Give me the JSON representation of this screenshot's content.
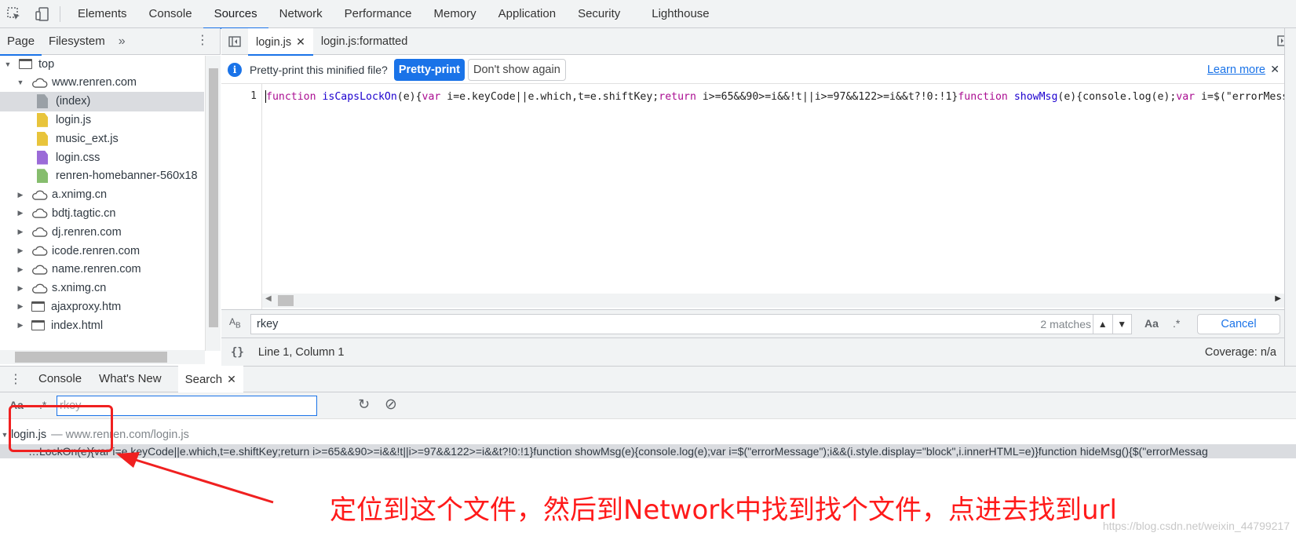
{
  "main_tabs": [
    "Elements",
    "Console",
    "Sources",
    "Network",
    "Performance",
    "Memory",
    "Application",
    "Security",
    "Lighthouse"
  ],
  "active_main_tab": "Sources",
  "navigator": {
    "tabs": [
      "Page",
      "Filesystem"
    ],
    "more": "»",
    "tree": [
      {
        "label": "top",
        "type": "frame",
        "expanded": true,
        "depth": 0
      },
      {
        "label": "www.renren.com",
        "type": "domain",
        "expanded": true,
        "depth": 1
      },
      {
        "label": "(index)",
        "type": "file-doc",
        "depth": 2,
        "selected": true
      },
      {
        "label": "login.js",
        "type": "file-script",
        "depth": 2
      },
      {
        "label": "music_ext.js",
        "type": "file-script",
        "depth": 2
      },
      {
        "label": "login.css",
        "type": "file-style",
        "depth": 2
      },
      {
        "label": "renren-homebanner-560x18",
        "type": "file-image",
        "depth": 2
      },
      {
        "label": "a.xnimg.cn",
        "type": "domain",
        "depth": 1
      },
      {
        "label": "bdtj.tagtic.cn",
        "type": "domain",
        "depth": 1
      },
      {
        "label": "dj.renren.com",
        "type": "domain",
        "depth": 1
      },
      {
        "label": "icode.renren.com",
        "type": "domain",
        "depth": 1
      },
      {
        "label": "name.renren.com",
        "type": "domain",
        "depth": 1
      },
      {
        "label": "s.xnimg.cn",
        "type": "domain",
        "depth": 1
      },
      {
        "label": "ajaxproxy.htm",
        "type": "frame",
        "depth": 1
      },
      {
        "label": "index.html",
        "type": "frame",
        "depth": 1
      }
    ]
  },
  "editor": {
    "tabs": [
      {
        "label": "login.js",
        "closable": true
      },
      {
        "label": "login.js:formatted",
        "closable": false
      }
    ],
    "infobar": {
      "message": "Pretty-print this minified file?",
      "primary": "Pretty-print",
      "secondary": "Don't show again",
      "learn_more": "Learn more"
    },
    "line_number": "1",
    "code_parts": [
      {
        "t": "function",
        "c": "kw"
      },
      {
        "t": " ",
        "c": ""
      },
      {
        "t": "isCapsLockOn",
        "c": "fn"
      },
      {
        "t": "(e){",
        "c": ""
      },
      {
        "t": "var",
        "c": "kw"
      },
      {
        "t": " i=e.keyCode||e.which,t=e.shiftKey;",
        "c": ""
      },
      {
        "t": "return",
        "c": "kw"
      },
      {
        "t": " i>=65&&90>=i&&!t||i>=97&&122>=i&&t?!0:!1}",
        "c": ""
      },
      {
        "t": "function",
        "c": "kw"
      },
      {
        "t": " ",
        "c": ""
      },
      {
        "t": "showMsg",
        "c": "fn"
      },
      {
        "t": "(e){console.log(e);",
        "c": ""
      },
      {
        "t": "var",
        "c": "kw"
      },
      {
        "t": " i=$(\"errorMessage\");i&&(i.style.display=\"block\",i.innerHTML=e)}",
        "c": ""
      }
    ],
    "find": {
      "query": "rkey",
      "matches": "2 matches",
      "case_label": "Aa",
      "regex_label": ".*",
      "cancel": "Cancel"
    },
    "status": {
      "position": "Line 1, Column 1",
      "coverage": "Coverage: n/a",
      "format_icon": "{}"
    }
  },
  "drawer": {
    "tabs": [
      {
        "label": "Console"
      },
      {
        "label": "What's New"
      },
      {
        "label": "Search",
        "closable": true
      }
    ],
    "search": {
      "case_label": "Aa",
      "regex_label": ".*",
      "value": "rkey"
    },
    "result": {
      "file": "login.js",
      "separator": "—",
      "path": "www.renren.com/login.js",
      "line": "…LockOn(e){var i=e.keyCode||e.which,t=e.shiftKey;return i>=65&&90>=i&&!t||i>=97&&122>=i&&t?!0:!1}function showMsg(e){console.log(e);var i=$(\"errorMessage\");i&&(i.style.display=\"block\",i.innerHTML=e)}function hideMsg(){$(\"errorMessag"
    }
  },
  "annotation": {
    "text": "定位到这个文件，然后到Network中找到找个文件，点进去找到url",
    "color": "#ff1a1a"
  },
  "watermark": "https://blog.csdn.net/weixin_44799217",
  "colors": {
    "accent": "#1a73e8",
    "annotation": "#f02020"
  }
}
